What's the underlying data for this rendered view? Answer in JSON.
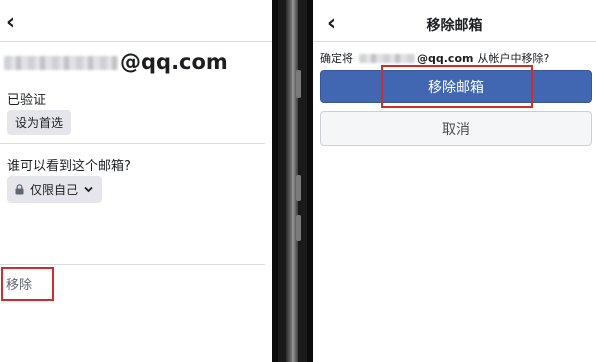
{
  "left": {
    "email_domain": "@qq.com",
    "verified_label": "已验证",
    "set_primary_label": "设为首选",
    "visibility_question": "谁可以看到这个邮箱?",
    "privacy_option": "仅限自己",
    "remove_label": "移除"
  },
  "right": {
    "title": "移除邮箱",
    "confirm_prefix": "确定将",
    "confirm_email_domain": "@qq.com",
    "confirm_suffix": "从帐户中移除?",
    "remove_button_label": "移除邮箱",
    "cancel_button_label": "取消"
  },
  "icons": {
    "back": "chevron-left-icon",
    "lock": "lock-icon",
    "dropdown": "chevron-down-icon"
  },
  "colors": {
    "primary": "#4267b2",
    "highlight": "#d32a2a"
  }
}
